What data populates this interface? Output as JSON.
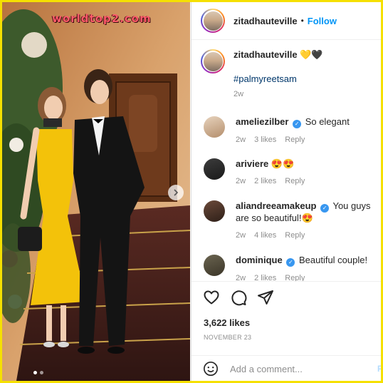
{
  "watermark": "worldtop2.com",
  "post": {
    "header": {
      "username": "zitadhauteville",
      "separator": "•",
      "follow_label": "Follow"
    },
    "caption": {
      "username": "zitadhauteville",
      "emojis": "💛🖤",
      "hashtag": "#palmyreetsam",
      "time": "2w"
    },
    "comments": [
      {
        "username": "ameliezilber",
        "verified": true,
        "text": "So elegant",
        "time": "2w",
        "likes": "3 likes",
        "reply": "Reply"
      },
      {
        "username": "ariviere",
        "verified": false,
        "text": "😍😍",
        "time": "2w",
        "likes": "2 likes",
        "reply": "Reply"
      },
      {
        "username": "aliandreeamakeup",
        "verified": true,
        "text": "You guys are so beautiful!😍",
        "time": "2w",
        "likes": "4 likes",
        "reply": "Reply"
      },
      {
        "username": "dominique",
        "verified": true,
        "text": "Beautiful couple!",
        "time": "2w",
        "likes": "2 likes",
        "reply": "Reply"
      }
    ],
    "icons": [
      "heart-icon",
      "comment-icon",
      "share-icon",
      "next-arrow-icon",
      "emoji-icon"
    ],
    "likes": "3,622 likes",
    "date": "NOVEMBER 23",
    "add_comment_placeholder": "Add a comment...",
    "post_label": "P"
  },
  "carousel": {
    "current": 1,
    "total": 2
  },
  "colors": {
    "frame": "#f5e000",
    "accent": "#0095f6",
    "dress": "#f3c20a"
  }
}
